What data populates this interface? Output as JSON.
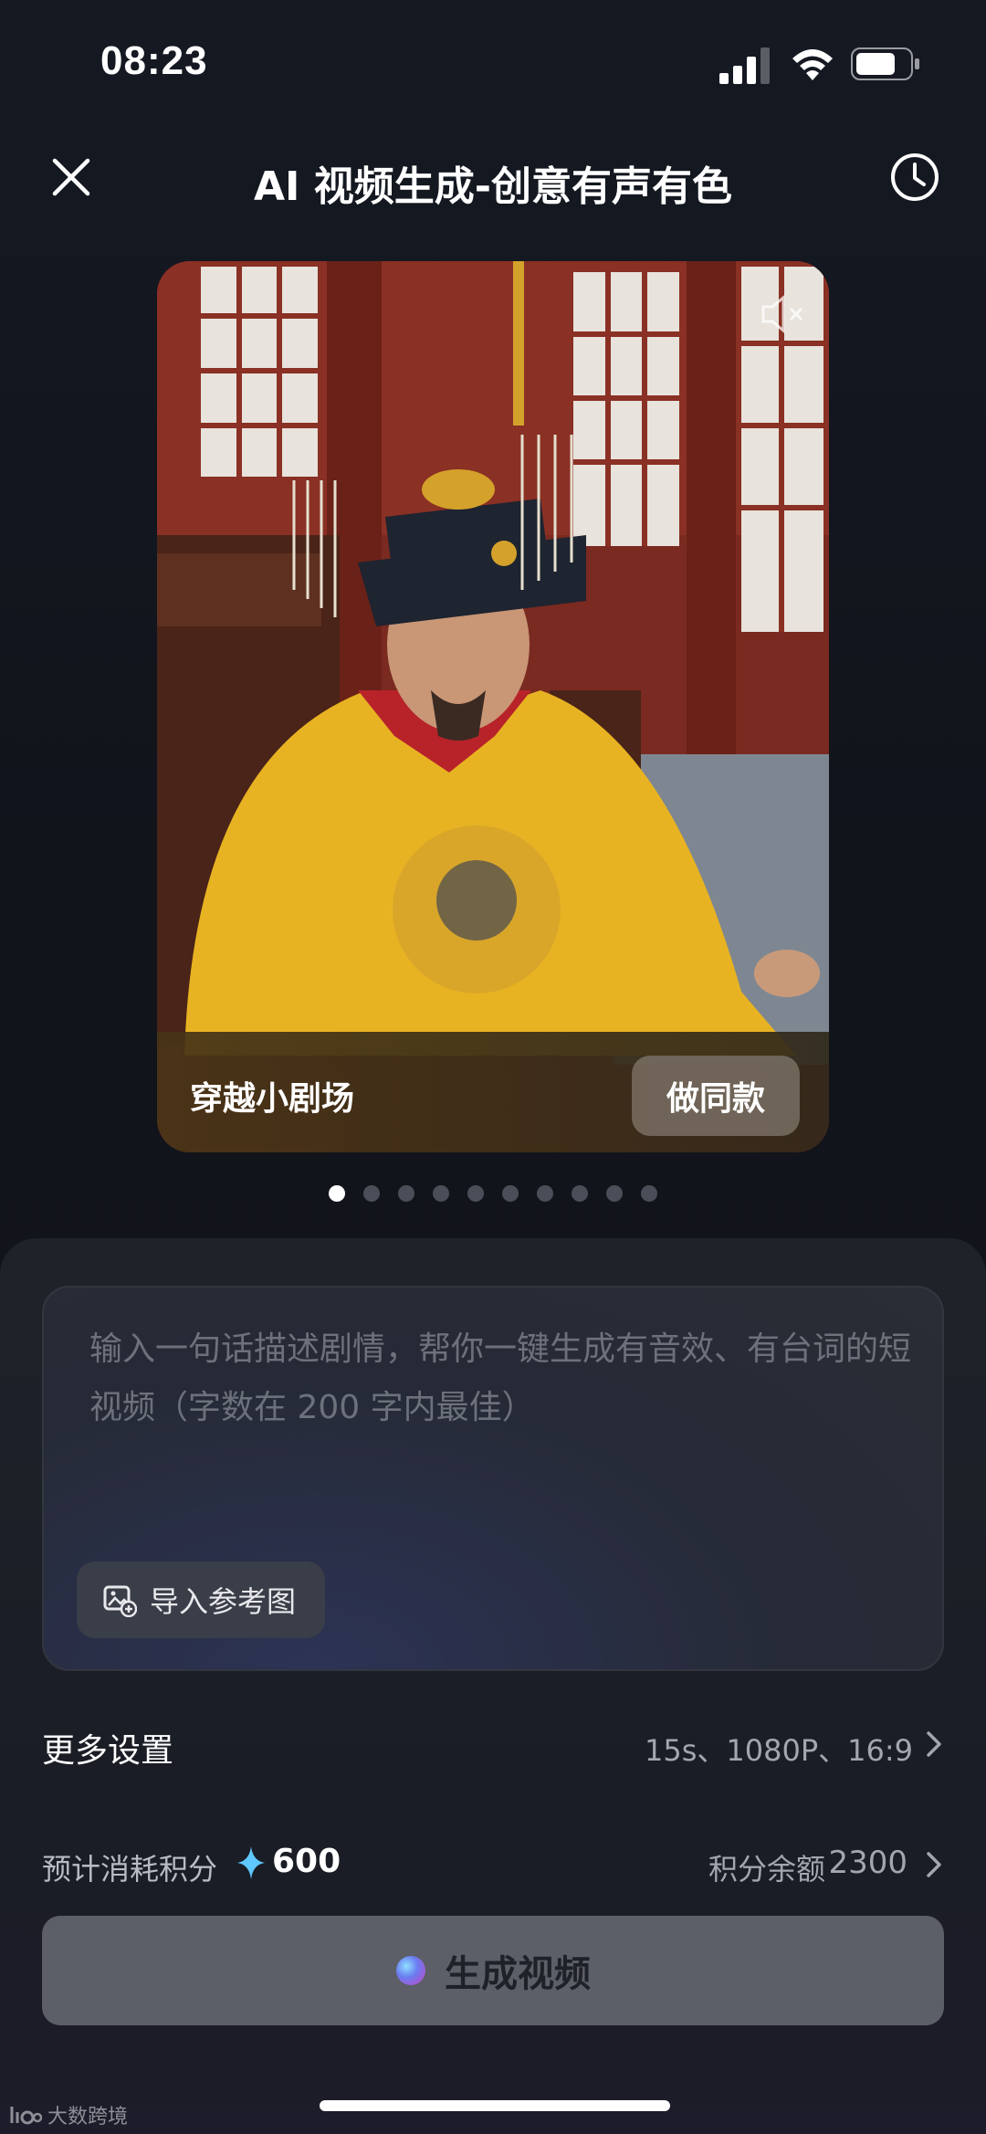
{
  "status_bar": {
    "time": "08:23",
    "icons": [
      "signal-icon",
      "wifi-icon",
      "battery-icon"
    ]
  },
  "header": {
    "title": "AI 视频生成-创意有声有色",
    "left_icon": "close-icon",
    "right_icon": "history-icon"
  },
  "card": {
    "caption": "穿越小剧场",
    "action_label": "做同款",
    "icon": "mute-icon",
    "image": "emperor-in-yellow-dragon-robe"
  },
  "pagination": {
    "total": 10,
    "active_index": 0
  },
  "prompt": {
    "placeholder": "输入一句话描述剧情，帮你一键生成有音效、有台词的短视频（字数在 200 字内最佳）",
    "import_label": "导入参考图",
    "import_icon": "image-add-icon"
  },
  "settings": {
    "label": "更多设置",
    "value": "15s、1080P、16:9"
  },
  "credits": {
    "cost_label": "预计消耗积分",
    "cost_value": "600",
    "balance_label": "积分余额",
    "balance_value": "2300"
  },
  "generate": {
    "label": "生成视频"
  },
  "watermark": {
    "text": "大数跨境"
  },
  "colors": {
    "background": "#11141b",
    "panel": "#1e2229",
    "accent_sparkle": "#5ec8ff",
    "button_disabled": "#5c5f67",
    "robe_yellow": "#e8b322"
  }
}
